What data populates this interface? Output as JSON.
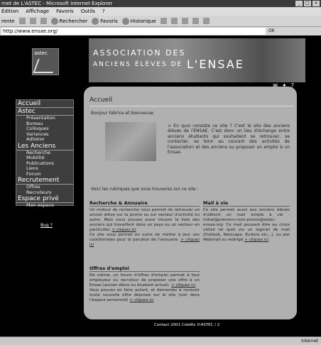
{
  "window": {
    "title": "rnet de L'ASTEC - Microsoft Internet Explorer"
  },
  "menu": [
    "Édition",
    "Affichage",
    "Favoris",
    "Outils",
    "?"
  ],
  "toolbar": {
    "back": "rente",
    "search": "Rechercher",
    "favorites": "Favoris",
    "history": "Historique"
  },
  "address": {
    "url": "http://www.ensae.org/",
    "go": "OK"
  },
  "logo": {
    "text": "astec"
  },
  "banner": {
    "line1": "ASSOCIATION DES",
    "line2": "ANCIENS ÉLÈVES DE",
    "line3": "L'ENSAE"
  },
  "sidebar": {
    "accueil": "Accueil",
    "astec": {
      "title": "Astec",
      "items": [
        "Présentation",
        "Bureau",
        "Colloques",
        "Variances",
        "Adhérer"
      ]
    },
    "anciens": {
      "title": "Les Anciens",
      "items": [
        "Recherche",
        "Mobilité",
        "Publications",
        "Liens",
        "Forum"
      ]
    },
    "recrutement": {
      "title": "Recrutement",
      "items": [
        "Offres",
        "Recruteurs"
      ]
    },
    "prive": {
      "title": "Espace privé",
      "items": [
        "Mon espace"
      ]
    }
  },
  "bug": "Bug ?",
  "panel": {
    "title": "Accueil",
    "greeting": "Bonjour Fabrice et bienvenue",
    "intro": "> En quoi consiste ce site ? C'est le site des anciens élèves de l'ENSAE. C'est donc un lieu d'échange entre anciens étudiants qui souhaitent se retrouver, se contacter, se tenir au courant des activités de l'association et des anciens ou proposer un emploi à un Ensae.",
    "rubriques": "Voici les rubriques que vous trouverez sur ce site :",
    "box1": {
      "title": "Recherche & Annuaire",
      "text": "Un moteur de recherche vous permet de retrouver un ancien élève sur la promo ou sur secteur d'activité ou autre. Mais vous pouvez aussi trouver la liste des anciens qui travaillent dans un pays ou un secteur en particulier.",
      "link1": "> cliquez ici",
      "text2": "Ce site vous permet en outre de mettre à jour vos coordonnées pour la parution de l'annuaire.",
      "link2": "> cliquez ici"
    },
    "box2": {
      "title": "Mail à vie",
      "text": "Ce site permet aussi aux anciens élèves d'obtenir un mail simple à vie : initial@prénom+nom-promo@astec-ensae.org. Ce mail pouvant être au choix utilisé tel quel via un logiciel de mail (Outlook, Netscape, Eudora etc...), ou par Webmail ou redirigé",
      "link": "> cliquez ici"
    },
    "box3": {
      "title": "Offres d'emploi",
      "text": "De même, un forum d'offres d'emploi permet à tout employeur ou recruteur de proposer une offre à un Ensae (ancien élève ou étudiant actuel).",
      "link1": "> cliquez ici",
      "text2": "Vous pouvez en faire autant, et demander à recevoir toute nouvelle offre déposée sur le site (voir dans l'espace personnel)",
      "link2": "> cliquez ici"
    }
  },
  "footer": {
    "text": "Contact 2001  Crédits ©ASTEC / 2"
  },
  "status": {
    "zone": "Internet"
  }
}
